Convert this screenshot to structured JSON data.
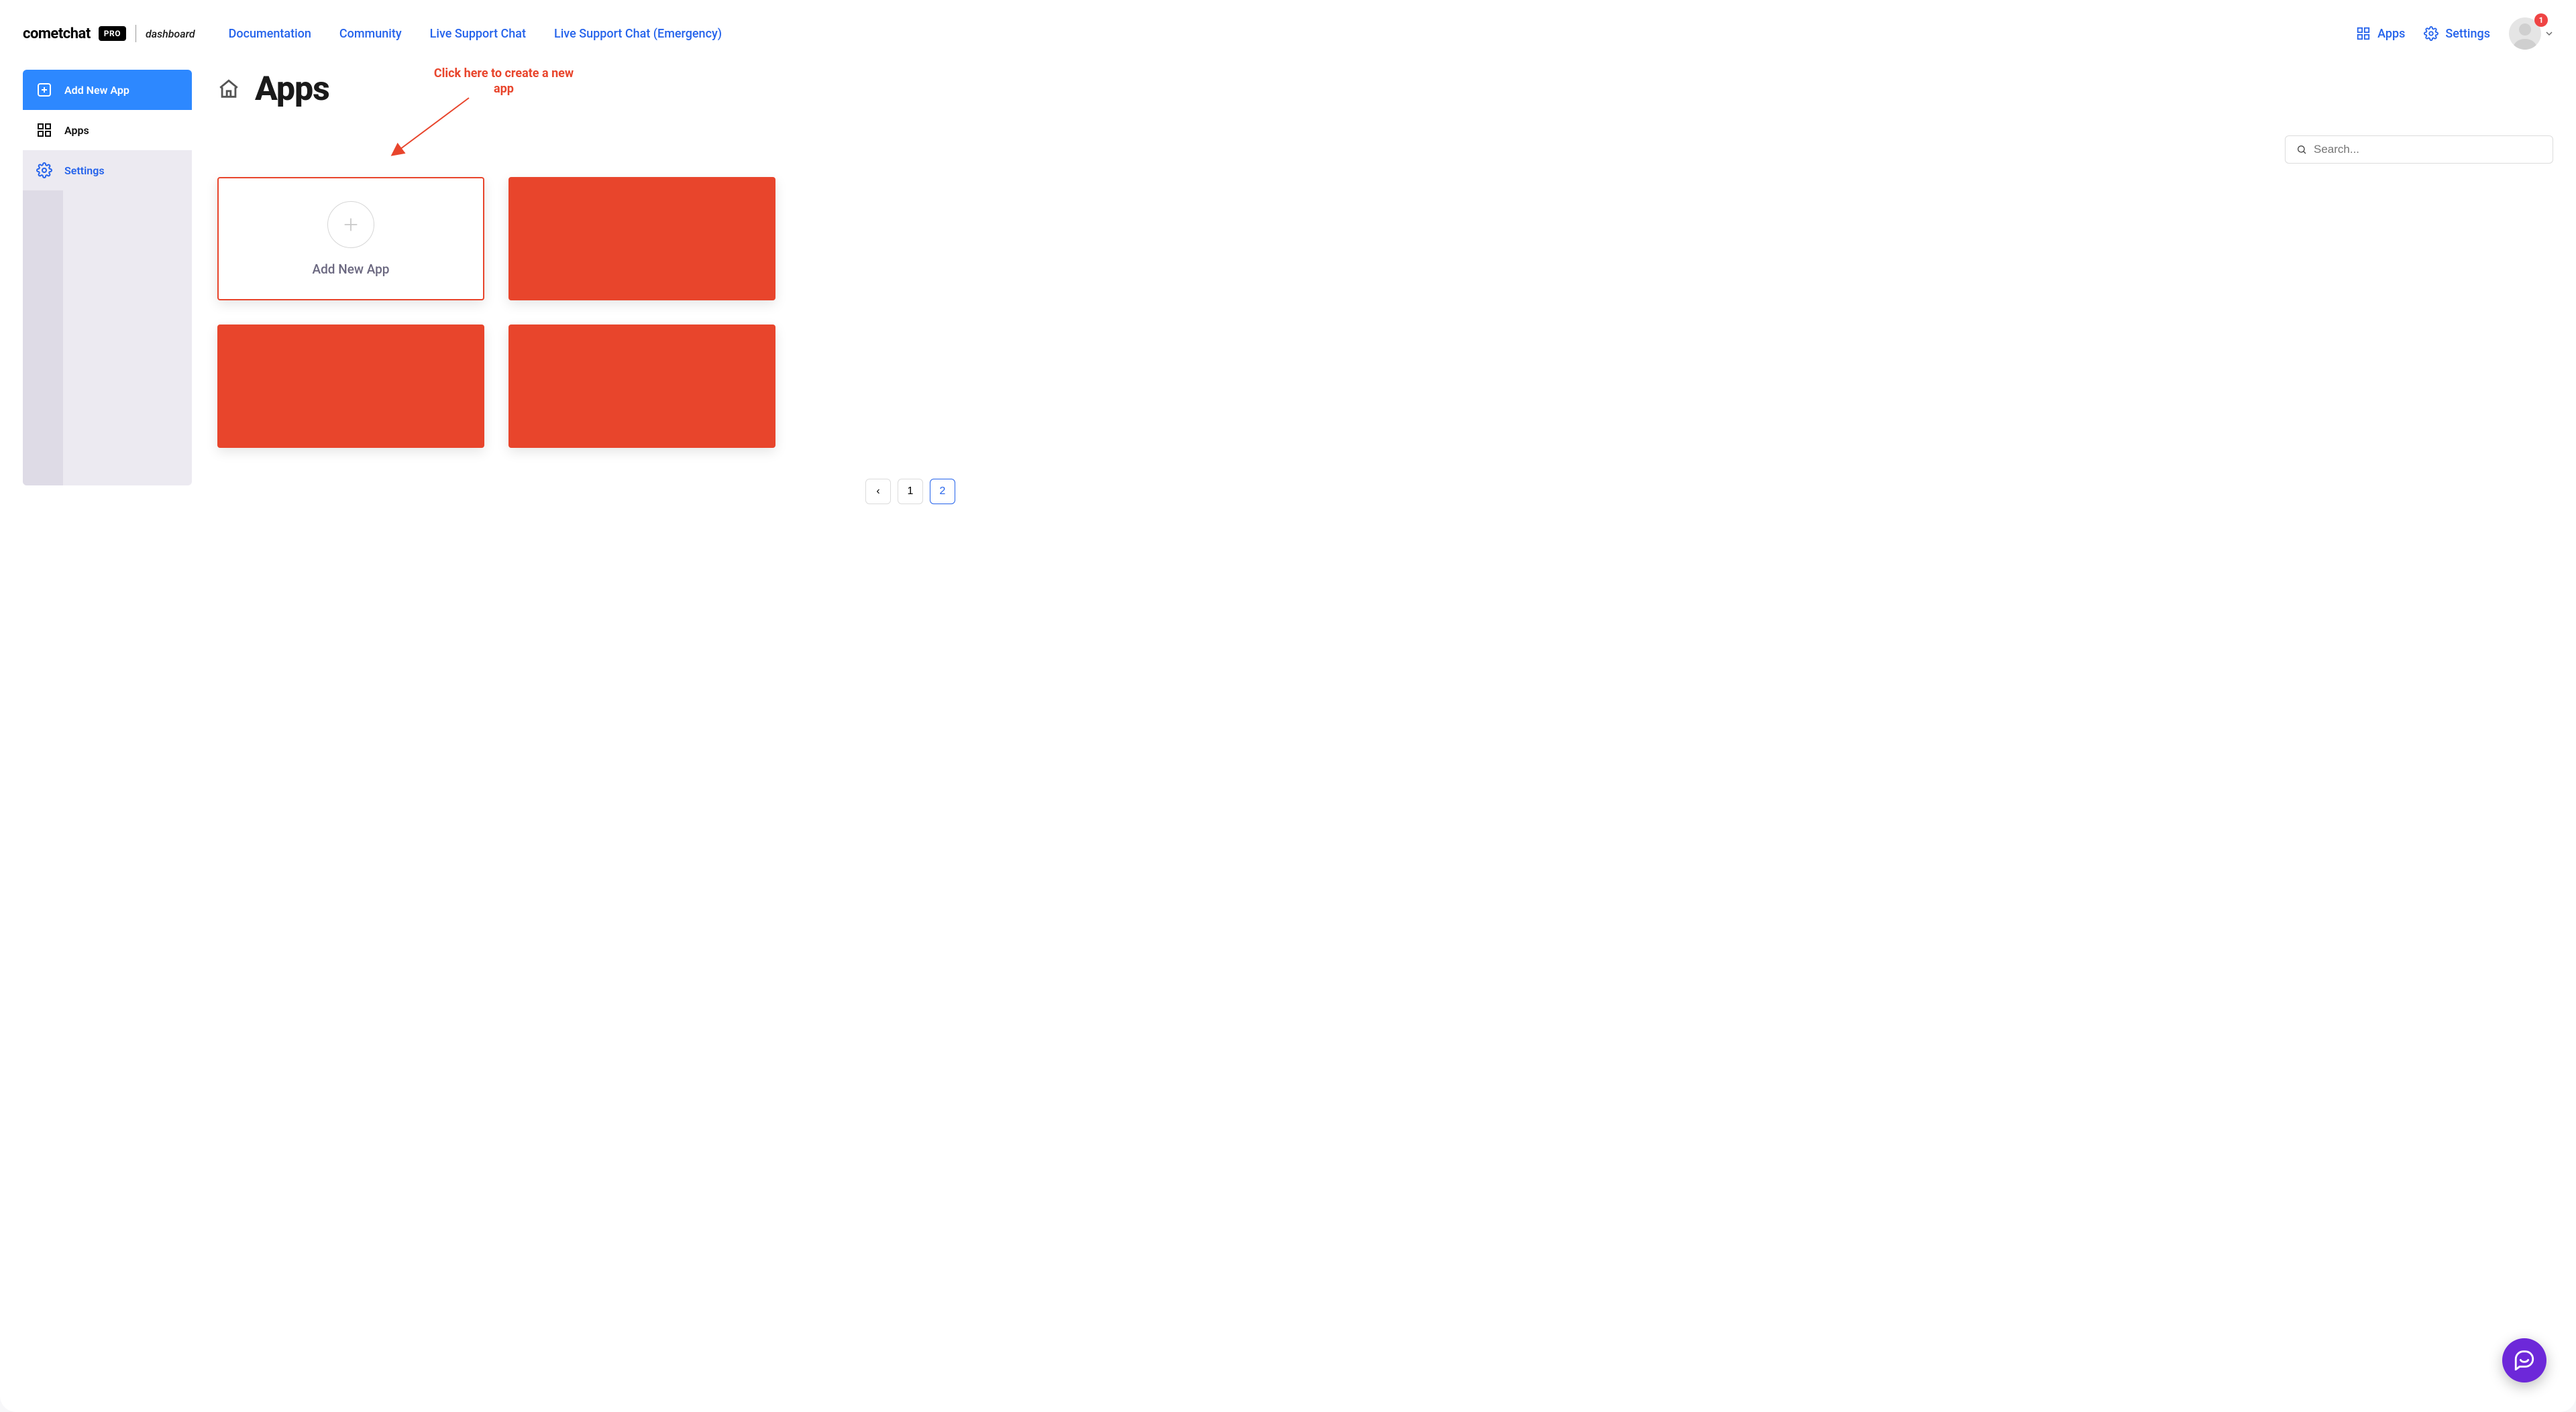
{
  "logo": {
    "brand": "cometchat",
    "badge": "PRO",
    "suffix": "dashboard"
  },
  "topnav": {
    "documentation": "Documentation",
    "community": "Community",
    "support": "Live Support Chat",
    "emergency": "Live Support Chat (Emergency)"
  },
  "header": {
    "apps_link": "Apps",
    "settings_link": "Settings",
    "notification_count": "1"
  },
  "sidebar": {
    "add_new_app": "Add New App",
    "apps": "Apps",
    "settings": "Settings"
  },
  "page": {
    "title": "Apps",
    "search_placeholder": "Search..."
  },
  "annotation": "Click here to create a new app",
  "add_card": {
    "label": "Add New App"
  },
  "pagination": {
    "prev": "‹",
    "page1": "1",
    "page2": "2"
  }
}
